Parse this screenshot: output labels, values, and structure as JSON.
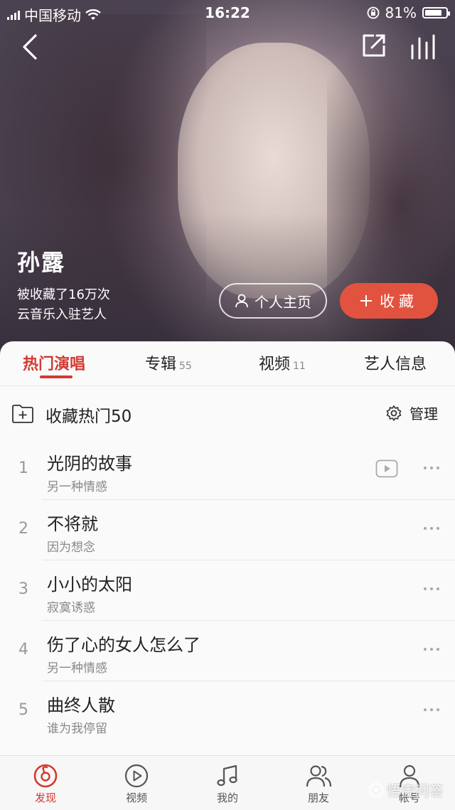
{
  "status_bar": {
    "carrier": "中国移动",
    "time": "16:22",
    "battery": "81%",
    "battery_level": 0.81
  },
  "artist": {
    "name": "孙露",
    "followers_text": "被收藏了16万次",
    "verified_text": "云音乐入驻艺人",
    "home_button": "个人主页",
    "favorite_button": "收藏"
  },
  "tabs": [
    {
      "label": "热门演唱",
      "count": ""
    },
    {
      "label": "专辑",
      "count": "55"
    },
    {
      "label": "视频",
      "count": "11"
    },
    {
      "label": "艺人信息",
      "count": ""
    }
  ],
  "collect_row": {
    "label": "收藏热门50",
    "manage_label": "管理"
  },
  "songs": [
    {
      "index": "1",
      "title": "光阴的故事",
      "album": "另一种情感",
      "has_mv": true
    },
    {
      "index": "2",
      "title": "不将就",
      "album": "因为想念",
      "has_mv": false
    },
    {
      "index": "3",
      "title": "小小的太阳",
      "album": "寂寞诱惑",
      "has_mv": false
    },
    {
      "index": "4",
      "title": "伤了心的女人怎么了",
      "album": "另一种情感",
      "has_mv": false
    },
    {
      "index": "5",
      "title": "曲终人散",
      "album": "谁为我停留",
      "has_mv": false
    }
  ],
  "bottom_nav": [
    {
      "label": "发现",
      "icon": "netease-logo-icon"
    },
    {
      "label": "视频",
      "icon": "video-icon"
    },
    {
      "label": "我的",
      "icon": "music-note-icon"
    },
    {
      "label": "朋友",
      "icon": "friends-icon"
    },
    {
      "label": "帐号",
      "icon": "person-icon"
    }
  ],
  "watermark": "悟空问答",
  "colors": {
    "accent": "#d33a31",
    "favorite_bg": "#e2533f"
  }
}
